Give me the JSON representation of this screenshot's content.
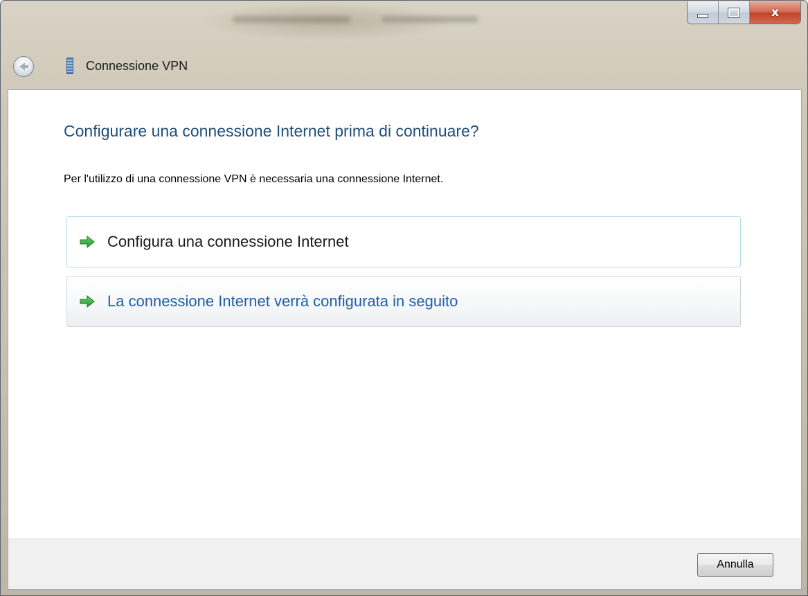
{
  "window": {
    "title": "Connessione VPN",
    "icon": "vpn-connection-icon"
  },
  "caption_buttons": {
    "minimize_icon": "minimize-icon",
    "maximize_icon": "maximize-icon",
    "close_icon": "close-icon",
    "close_glyph": "x"
  },
  "nav": {
    "back_icon": "back-arrow-icon"
  },
  "main": {
    "heading": "Configurare una connessione Internet prima di continuare?",
    "description": "Per l'utilizzo di una connessione VPN è necessaria una connessione Internet.",
    "options": [
      {
        "label": "Configura una connessione Internet",
        "icon": "green-arrow-icon"
      },
      {
        "label": "La connessione Internet verrà configurata in seguito",
        "icon": "green-arrow-icon"
      }
    ]
  },
  "footer": {
    "cancel_label": "Annulla"
  },
  "colors": {
    "heading": "#1f4e79",
    "link": "#1f5ea8",
    "arrow": "#2fae3c",
    "close_button": "#c0452a"
  }
}
